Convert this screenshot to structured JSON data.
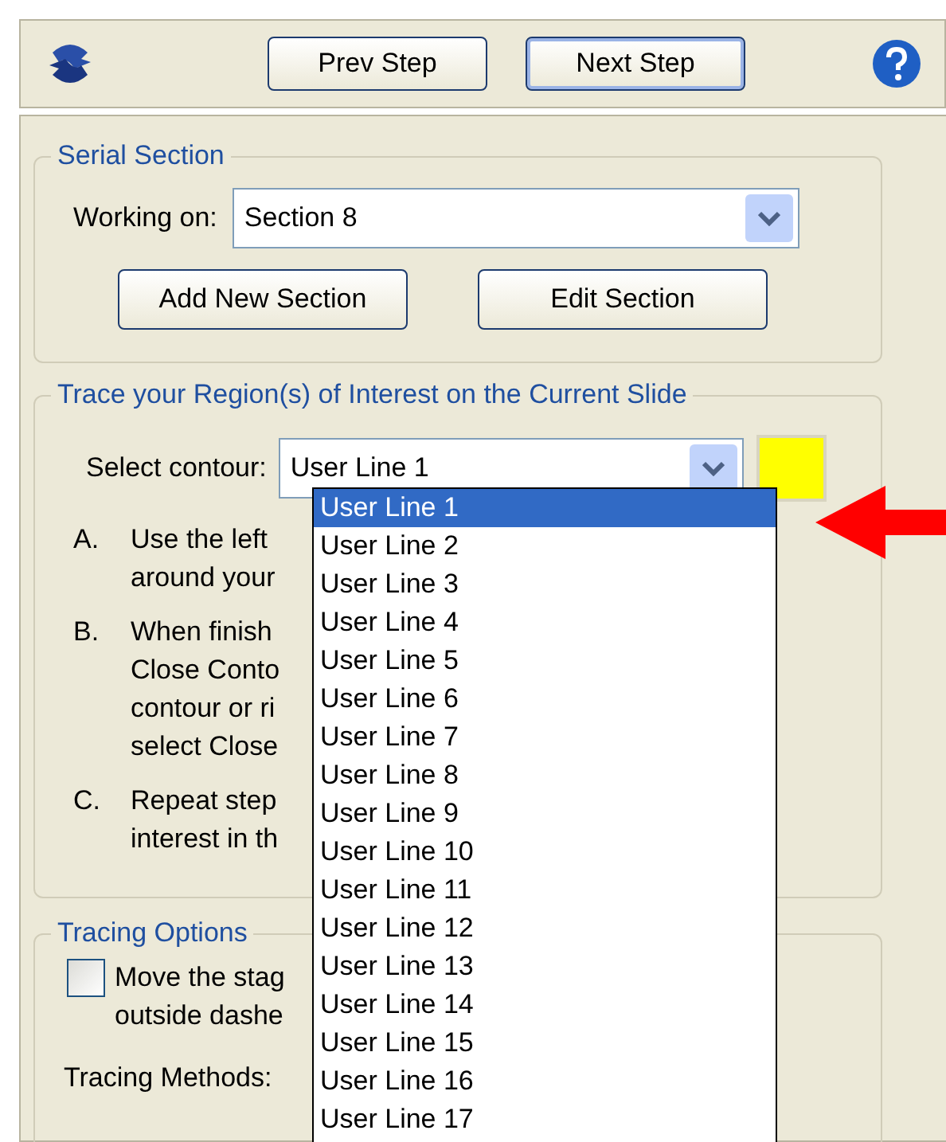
{
  "toolbar": {
    "prev_button": "Prev Step",
    "next_button": "Next Step"
  },
  "serial_section": {
    "title": "Serial Section",
    "working_on_label": "Working on:",
    "section_select": {
      "value": "Section 8"
    },
    "buttons": [
      "Add New Section",
      "Edit Section"
    ]
  },
  "trace": {
    "title": "Trace your Region(s) of Interest on the Current Slide",
    "contour_label": "Select contour:",
    "contour_select": {
      "value": "User Line 1",
      "color": "#ffff00"
    },
    "steps": [
      {
        "marker": "A.",
        "text": "Use the left\naround your"
      },
      {
        "marker": "B.",
        "text": "When finish\nClose Conto\ncontour or ri\nselect Close"
      },
      {
        "marker": "C.",
        "text": "Repeat step\ninterest in th"
      }
    ],
    "dropdown": {
      "items": [
        {
          "label": "User Line 1",
          "selected": true
        },
        {
          "label": "User Line 2",
          "selected": false
        },
        {
          "label": "User Line 3",
          "selected": false
        },
        {
          "label": "User Line 4",
          "selected": false
        },
        {
          "label": "User Line 5",
          "selected": false
        },
        {
          "label": "User Line 6",
          "selected": false
        },
        {
          "label": "User Line 7",
          "selected": false
        },
        {
          "label": "User Line 8",
          "selected": false
        },
        {
          "label": "User Line 9",
          "selected": false
        },
        {
          "label": "User Line 10",
          "selected": false
        },
        {
          "label": "User Line 11",
          "selected": false
        },
        {
          "label": "User Line 12",
          "selected": false
        },
        {
          "label": "User Line 13",
          "selected": false
        },
        {
          "label": "User Line 14",
          "selected": false
        },
        {
          "label": "User Line 15",
          "selected": false
        },
        {
          "label": "User Line 16",
          "selected": false
        },
        {
          "label": "User Line 17",
          "selected": false
        }
      ]
    }
  },
  "tracing_options": {
    "title": "Tracing Options",
    "checkbox": {
      "text": "Move the stag\noutside dashe",
      "checked": false
    },
    "methods_label": "Tracing Methods:"
  }
}
